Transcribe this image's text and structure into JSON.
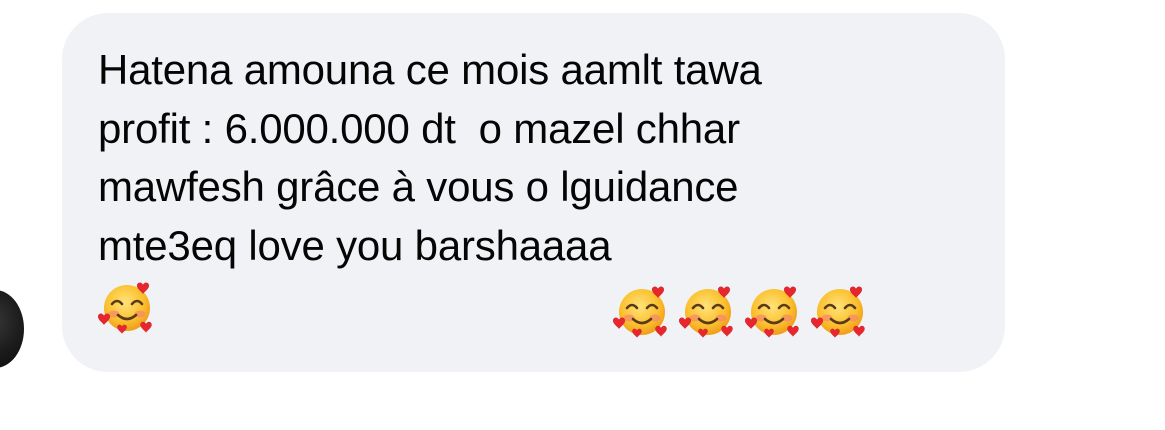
{
  "conversation": {
    "message": {
      "lines": [
        "Hatena amouna ce mois aamlt tawa",
        "profit : 6.000.000 dt  o mazel chhar",
        "mawfesh grâce à vous o lguidance",
        "mte3eq love you barshaaaa"
      ],
      "emojis": [
        "smiling-face-with-hearts-icon",
        "smiling-face-with-hearts-icon",
        "smiling-face-with-hearts-icon",
        "smiling-face-with-hearts-icon",
        "smiling-face-with-hearts-icon"
      ]
    },
    "colors": {
      "bubble": "#f0f2f5",
      "text": "#050505"
    }
  }
}
